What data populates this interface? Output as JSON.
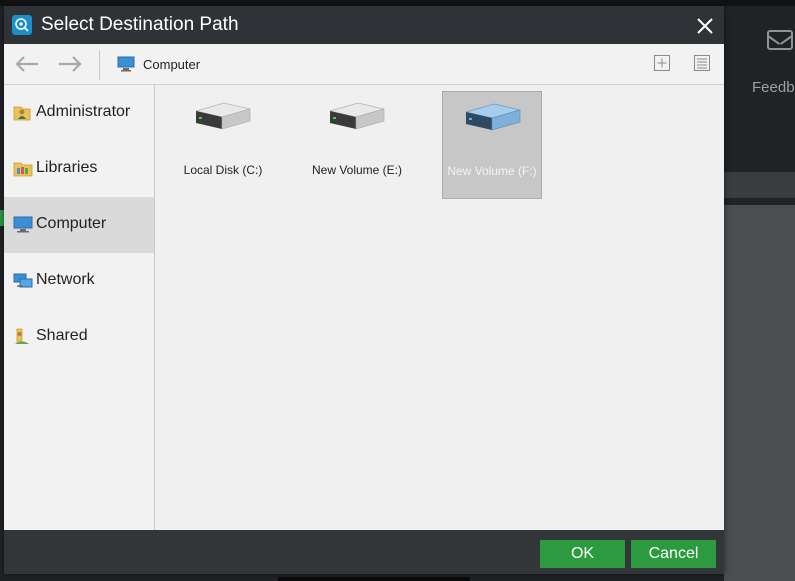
{
  "dialog": {
    "title": "Select Destination Path",
    "path": "Computer",
    "ok_label": "OK",
    "cancel_label": "Cancel"
  },
  "sidebar": {
    "items": [
      {
        "label": "Administrator",
        "icon": "user-folder-icon"
      },
      {
        "label": "Libraries",
        "icon": "libraries-icon"
      },
      {
        "label": "Computer",
        "icon": "computer-icon",
        "selected": true
      },
      {
        "label": "Network",
        "icon": "network-icon"
      },
      {
        "label": "Shared",
        "icon": "shared-folder-icon"
      }
    ]
  },
  "drives": [
    {
      "label": "Local Disk (C:)",
      "icon": "hard-drive-icon"
    },
    {
      "label": "New Volume (E:)",
      "icon": "hard-drive-icon"
    },
    {
      "label": "New Volume (F:)",
      "icon": "hard-drive-icon",
      "selected": true
    }
  ],
  "background": {
    "feedback_label": "Feedb"
  },
  "colors": {
    "accent_green": "#2c9a3e",
    "titlebar": "#2f3236",
    "selected_drive_icon": "#7fb0dc"
  }
}
